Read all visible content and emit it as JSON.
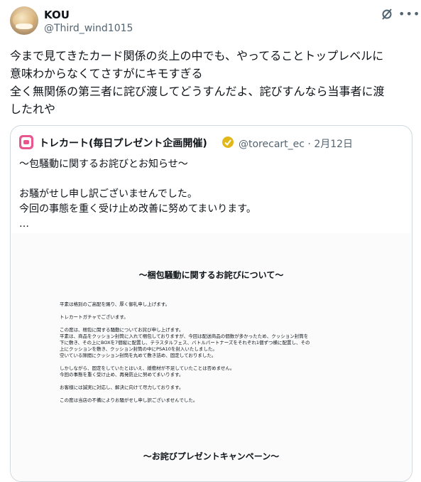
{
  "tweet": {
    "author_name": "KOU",
    "author_handle": "@Third_wind1015",
    "text_lines": [
      "今まで見てきたカード関係の炎上の中でも、やってることトップレベルに",
      "意味わからなくてさすがにキモすぎる",
      "全く無関係の第三者に詫び渡してどうすんだよ、詫びすんなら当事者に渡",
      "したれや"
    ]
  },
  "quote": {
    "author_name": "トレカート(毎日プレゼント企画開催)",
    "author_handle": "@torecart_ec",
    "separator": "·",
    "date": "2月12日",
    "text_lines": [
      "〜包騒動に関するお詫びとお知らせ〜",
      "",
      "お騒がせし申し訳ございませんでした。",
      "今回の事態を重く受け止め改善に努めてまいります。",
      "…"
    ],
    "image": {
      "title": "〜梱包騒動に関するお詫びについて〜",
      "body_lines": [
        "平素は格別のご高配を賜り、厚く御礼申し上げます。",
        "",
        "トレカートガチャでございます。",
        "",
        "この度は、梱包に関する騒動についてお詫び申し上げます。",
        "平素は、商品をクッション封筒に入れて梱包しておりますが、今回は配送商品の個数が多かったため、クッション封筒を",
        "下に敷き、その上にBOXを7個縦に配置し、テラスタルフェス、バトルパートナーズをそれぞれ1個ずつ横に配置し、その",
        "上にクッションを敷き、クッション封筒の中にPSA10を封入いたしました。",
        "空いている隙間にクッション封筒を丸めて敷き詰め、固定しておりました。",
        "",
        "しかしながら、固定をしていたとはいえ、緩衝材が不足していたことは否めません。",
        "今回の事態を重く受け止め、再発防止に努めてまいります。",
        "",
        "お客様には誠実に対応し、解決に向けて尽力しております。",
        "",
        "この度は当店の不備によりお騒がせし申し訳ございませんでした。"
      ],
      "footer_title": "〜お詫びプレゼントキャンペーン〜"
    }
  },
  "icons": {
    "grok": "grok-icon",
    "more": "more-icon",
    "verified": "verified-badge-icon"
  },
  "colors": {
    "text": "#0f1419",
    "secondary": "#536471",
    "border": "#cfd9de",
    "verified_gold": "#e2b719",
    "brand_pink": "#e8568d"
  }
}
